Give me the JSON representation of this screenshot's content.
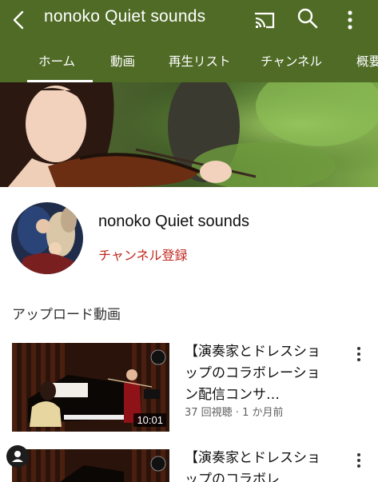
{
  "header": {
    "channel_title": "nonoko Quiet sounds",
    "icons": [
      "back-icon",
      "cast-icon",
      "search-icon",
      "more-vert-icon"
    ],
    "bar_color": "#4f6b26"
  },
  "tabs": [
    {
      "label": "ホーム",
      "active": true
    },
    {
      "label": "動画",
      "active": false
    },
    {
      "label": "再生リスト",
      "active": false
    },
    {
      "label": "チャンネル",
      "active": false
    },
    {
      "label": "概要",
      "active": false
    }
  ],
  "channel": {
    "name": "nonoko Quiet sounds",
    "subscribe_label": "チャンネル登録",
    "subscribe_color": "#c0281e"
  },
  "uploads": {
    "section_title": "アップロード動画",
    "videos": [
      {
        "title": "【演奏家とドレスショップのコラボレーション配信コンサ…",
        "duration": "10:01",
        "meta": "37 回視聴 · 1 か月前"
      },
      {
        "title": "【演奏家とドレスショップのコラボレ"
      }
    ]
  }
}
